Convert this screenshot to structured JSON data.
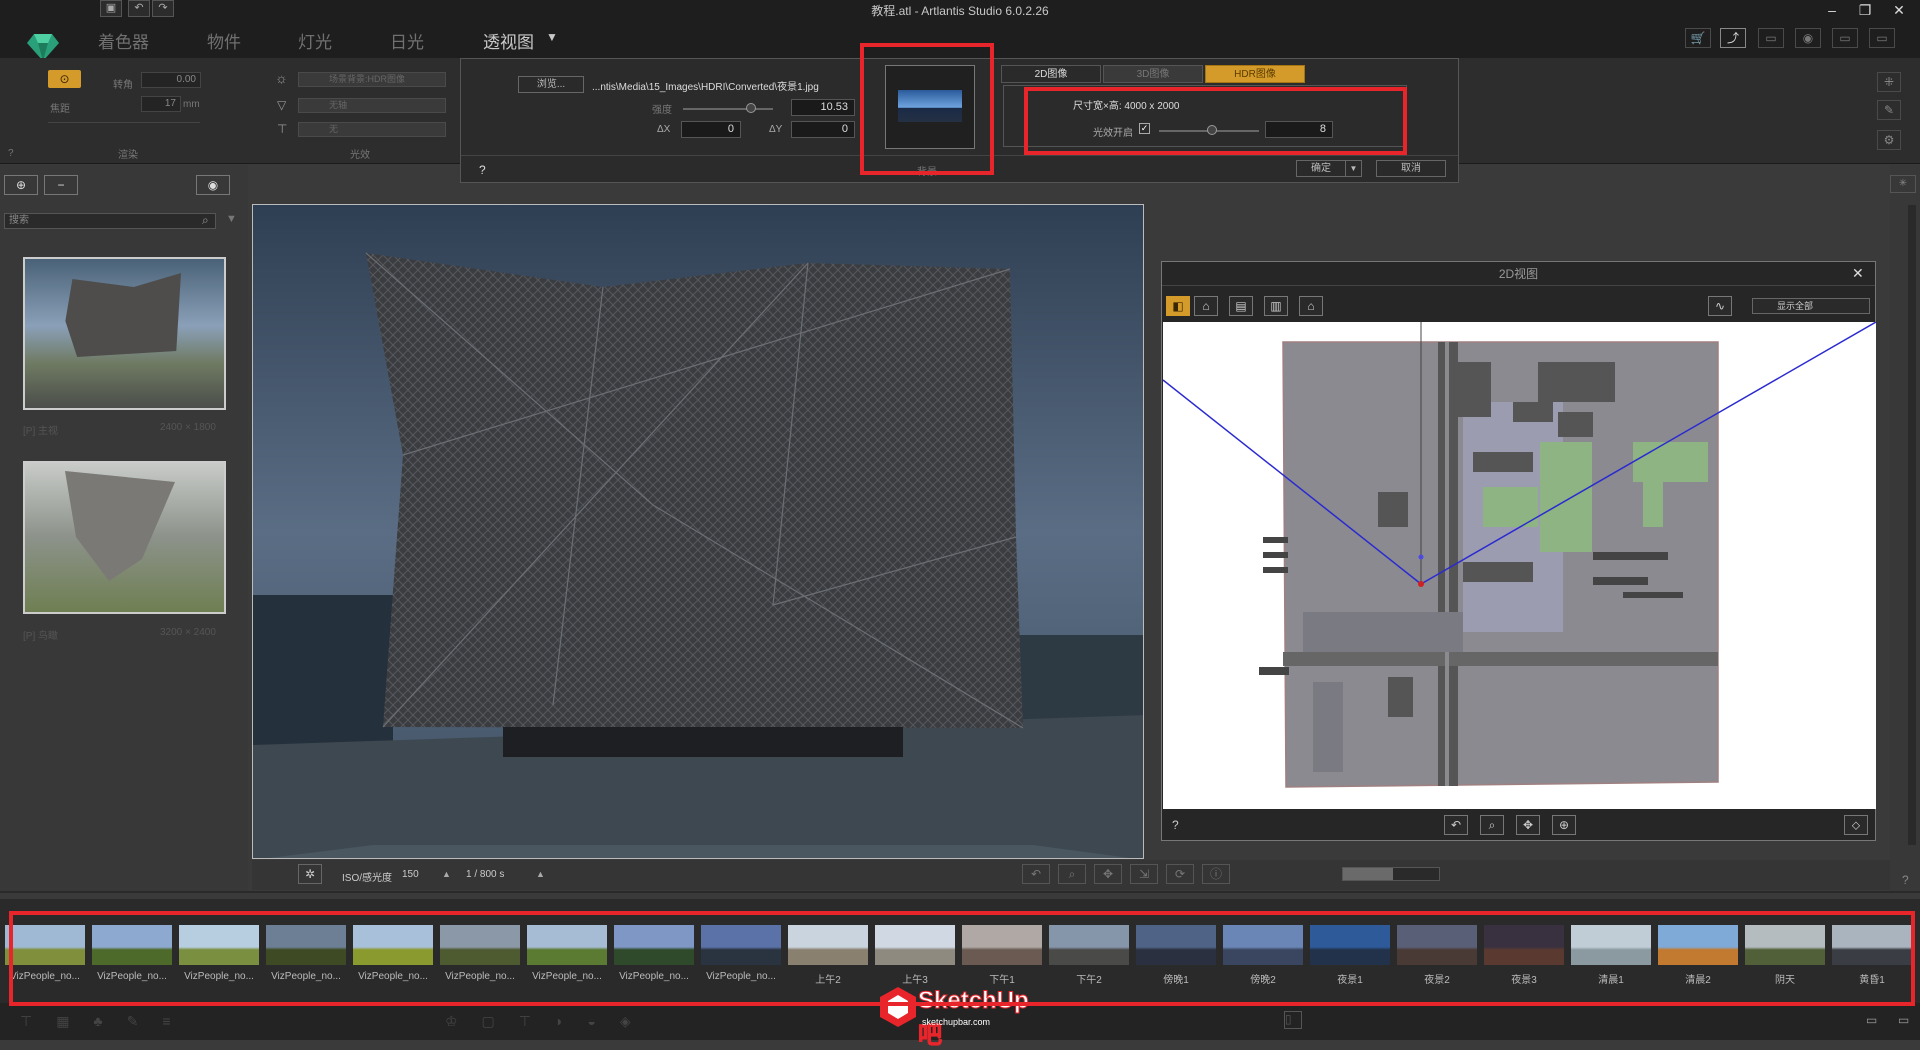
{
  "window": {
    "title": "教程.atl - Artlantis Studio 6.0.2.26",
    "minimize": "–",
    "maximize": "❐",
    "close": "✕"
  },
  "menu": {
    "items": [
      "着色器",
      "物件",
      "灯光",
      "日光",
      "透视图"
    ],
    "active_index": 4,
    "dropdown_arrow": "▼"
  },
  "quick_icons": [
    "save-icon",
    "undo-icon",
    "redo-icon"
  ],
  "settings": {
    "camera": {
      "roll_label": "转角",
      "roll_value": "0.00",
      "focal_label": "焦距",
      "focal_value": "17",
      "focal_unit": "mm",
      "render_label": "渲染"
    },
    "environment": {
      "background_value": "场景背景:HDR图像",
      "ground_value": "无轴",
      "foreground_value": "无",
      "effects_label": "光效"
    },
    "help": "?"
  },
  "dialog": {
    "browse_label": "浏览...",
    "path": "...ntis\\Media\\15_Images\\HDRI\\Converted\\夜景1.jpg",
    "strength_label": "强度",
    "strength_value": "10.53",
    "dx_label": "ΔX",
    "dx_value": "0",
    "dy_label": "ΔY",
    "dy_value": "0",
    "preview_caption": "背景",
    "tabs": [
      "2D图像",
      "3D图像",
      "HDR图像"
    ],
    "size_label": "尺寸宽×高: 4000 x 2000",
    "light_label": "光效开启",
    "light_checked": "✓",
    "light_value": "8",
    "help": "?",
    "ok_label": "确定",
    "cancel_label": "取消",
    "ok_arrow": "▼"
  },
  "left_panel": {
    "search_placeholder": "搜索",
    "thumbs": [
      {
        "label": "[P] 主视",
        "size": "2400 × 1800"
      },
      {
        "label": "[P] 鸟瞰",
        "size": "3200 × 2400"
      }
    ]
  },
  "viewport_bar": {
    "iso_label": "ISO/感光度",
    "iso_value": "150",
    "shutter_label": "1 / 800 s",
    "up_arrow": "▲"
  },
  "view2d": {
    "title": "2D视图",
    "close": "✕",
    "display_value": "显示全部",
    "help": "?",
    "bottom_icons": [
      "undo-view-icon",
      "zoom-icon",
      "pan-icon",
      "zoom-extents-icon"
    ]
  },
  "hdri_strip": {
    "items": [
      {
        "label": "VizPeople_no...",
        "sky": "#9fb9d4",
        "ground": "#7f8f3c"
      },
      {
        "label": "VizPeople_no...",
        "sky": "#8ea9cf",
        "ground": "#4d6a2b"
      },
      {
        "label": "VizPeople_no...",
        "sky": "#b7cde0",
        "ground": "#7a8f3f"
      },
      {
        "label": "VizPeople_no...",
        "sky": "#6d7f95",
        "ground": "#3d4a24"
      },
      {
        "label": "VizPeople_no...",
        "sky": "#a9c0da",
        "ground": "#8b9a2f"
      },
      {
        "label": "VizPeople_no...",
        "sky": "#8a98a8",
        "ground": "#4e5a30"
      },
      {
        "label": "VizPeople_no...",
        "sky": "#a6bcd4",
        "ground": "#5b7a32"
      },
      {
        "label": "VizPeople_no...",
        "sky": "#7e97c4",
        "ground": "#2f4a2a"
      },
      {
        "label": "VizPeople_no...",
        "sky": "#5a72a8",
        "ground": "#2a3340"
      },
      {
        "label": "上午2",
        "sky": "#c9d4df",
        "ground": "#8a8070"
      },
      {
        "label": "上午3",
        "sky": "#cfd8e3",
        "ground": "#8f8a80"
      },
      {
        "label": "下午1",
        "sky": "#b0a8a4",
        "ground": "#6a5a52"
      },
      {
        "label": "下午2",
        "sky": "#8696aa",
        "ground": "#4a4a48"
      },
      {
        "label": "傍晚1",
        "sky": "#4e6386",
        "ground": "#2a3040"
      },
      {
        "label": "傍晚2",
        "sky": "#6a86b6",
        "ground": "#3a4660"
      },
      {
        "label": "夜景1",
        "sky": "#2f5a9a",
        "ground": "#22324a"
      },
      {
        "label": "夜景2",
        "sky": "#5a5f78",
        "ground": "#4a3a36"
      },
      {
        "label": "夜景3",
        "sky": "#3a3140",
        "ground": "#5a3a30"
      },
      {
        "label": "清晨1",
        "sky": "#c0ccd6",
        "ground": "#8a9aa0"
      },
      {
        "label": "清晨2",
        "sky": "#7fa9d6",
        "ground": "#c27a30"
      },
      {
        "label": "阴天",
        "sky": "#b4bcc0",
        "ground": "#52603a"
      },
      {
        "label": "黄昏1",
        "sky": "#aab4bf",
        "ground": "#3a3e44"
      }
    ]
  },
  "watermark": {
    "brand": "SketchUp吧",
    "url": "sketchupbar.com"
  }
}
